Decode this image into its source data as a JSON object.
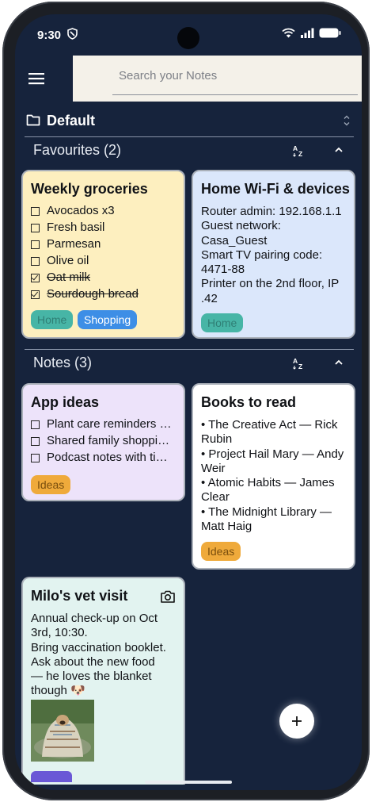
{
  "status": {
    "time": "9:30"
  },
  "search": {
    "placeholder": "Search your Notes"
  },
  "notebook": {
    "name": "Default"
  },
  "sections": {
    "favourites": {
      "title": "Favourites (2)"
    },
    "notes": {
      "title": "Notes (3)"
    }
  },
  "colors": {
    "background": "#16233c",
    "groceries_card": "#fdefbf",
    "wifi_card": "#dbe7fb",
    "app_ideas_card": "#ede3fa",
    "books_card": "#ffffff",
    "vet_card": "#e2f3f0",
    "label_home": "#47b5a6",
    "label_shopping": "#3d8ee6",
    "label_ideas": "#efaa3b"
  },
  "notes": {
    "groceries": {
      "title": "Weekly groceries",
      "items": [
        {
          "text": "Avocados x3",
          "checked": false
        },
        {
          "text": "Fresh basil",
          "checked": false
        },
        {
          "text": "Parmesan",
          "checked": false
        },
        {
          "text": "Olive oil",
          "checked": false
        },
        {
          "text": "Oat milk",
          "checked": true
        },
        {
          "text": "Sourdough bread",
          "checked": true
        }
      ],
      "labels": [
        "Home",
        "Shopping"
      ]
    },
    "wifi": {
      "title": "Home Wi-Fi & devices",
      "body": [
        "Router admin: 192.168.1.1",
        "Guest network:",
        "Casa_Guest",
        "Smart TV pairing code:",
        "4471-88",
        "Printer on the 2nd floor, IP",
        ".42"
      ],
      "labels": [
        "Home"
      ]
    },
    "app_ideas": {
      "title": "App ideas",
      "items": [
        {
          "text": "Plant care reminders with photo...",
          "checked": false
        },
        {
          "text": "Shared family shopping lists",
          "checked": false
        },
        {
          "text": "Podcast notes with timestamps",
          "checked": false
        }
      ],
      "labels": [
        "Ideas"
      ]
    },
    "books": {
      "title": "Books to read",
      "body": [
        "• The Creative Act — Rick",
        "Rubin",
        "• Project Hail Mary — Andy",
        "Weir",
        "• Atomic Habits — James",
        "Clear",
        "• The Midnight Library —",
        "Matt Haig"
      ],
      "labels": [
        "Ideas"
      ]
    },
    "vet": {
      "title": "Milo's vet visit",
      "body": [
        "Annual check-up on Oct",
        "3rd, 10:30.",
        "Bring vaccination booklet.",
        "Ask about the new food",
        "— he loves the blanket",
        "though 🐶"
      ]
    }
  },
  "icons": [
    "menu-icon",
    "folder-icon",
    "unfold-icon",
    "sort-az-icon",
    "collapse-icon",
    "camera-icon",
    "add-icon"
  ]
}
